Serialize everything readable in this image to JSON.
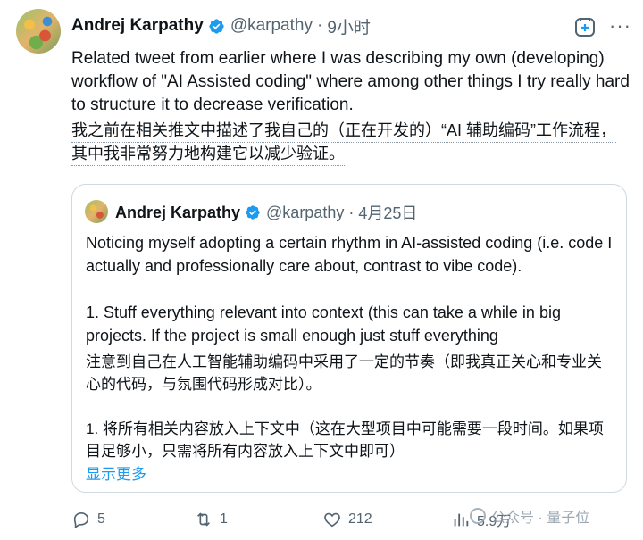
{
  "tweet": {
    "author_name": "Andrej Karpathy",
    "handle": "@karpathy",
    "separator": "·",
    "time": "9小时",
    "text_en": "Related tweet from earlier where I was describing my own (developing) workflow of \"AI Assisted coding\" where among other things I try really hard to structure it to decrease verification.",
    "text_zh_line1": "我之前在相关推文中描述了我自己的（正在开发的）“AI 辅助编码”工作流程，",
    "text_zh_line2": "其中我非常努力地构建它以减少验证。"
  },
  "quote": {
    "author_name": "Andrej Karpathy",
    "handle": "@karpathy",
    "separator": "·",
    "date": "4月25日",
    "text_en1": "Noticing myself adopting a certain rhythm in AI-assisted coding (i.e. code I actually and professionally care about, contrast to vibe code).",
    "text_en2": "1. Stuff everything relevant into context (this can take a while in big projects. If the project is small enough just stuff everything",
    "text_zh1": "注意到自己在人工智能辅助编码中采用了一定的节奏（即我真正关心和专业关心的代码，与氛围代码形成对比）。",
    "text_zh2": "1. 将所有相关内容放入上下文中（这在大型项目中可能需要一段时间。如果项目足够小，只需将所有内容放入上下文中即可）",
    "show_more": "显示更多"
  },
  "actions": {
    "replies": "5",
    "retweets": "1",
    "likes": "212",
    "views": "5.9万"
  },
  "watermark": "公众号 · 量子位",
  "icons": [
    "verified-badge-icon",
    "grok-icon",
    "more-icon",
    "reply-icon",
    "retweet-icon",
    "like-icon",
    "views-icon"
  ],
  "colors": {
    "accent": "#1d9bf0",
    "muted": "#536471",
    "border": "#cfd9de"
  }
}
